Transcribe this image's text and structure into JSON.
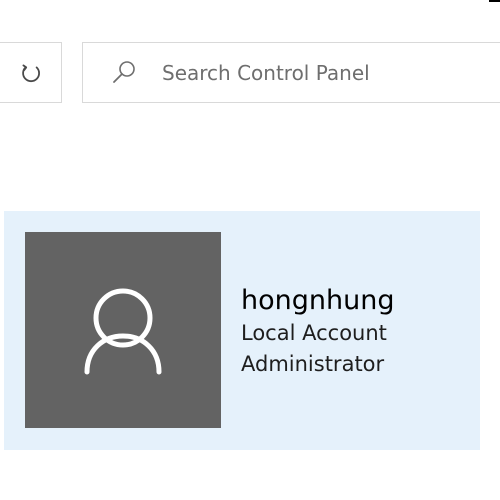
{
  "search": {
    "placeholder": "Search Control Panel",
    "value": ""
  },
  "toolbar": {
    "refresh_icon": "refresh-icon",
    "search_icon": "search-icon"
  },
  "account": {
    "name": "hongnhung",
    "type": "Local Account",
    "role": "Administrator",
    "avatar_icon": "user-icon"
  },
  "colors": {
    "card_background": "#e5f1fb",
    "avatar_background": "#636363",
    "border": "#d9d9d9"
  }
}
